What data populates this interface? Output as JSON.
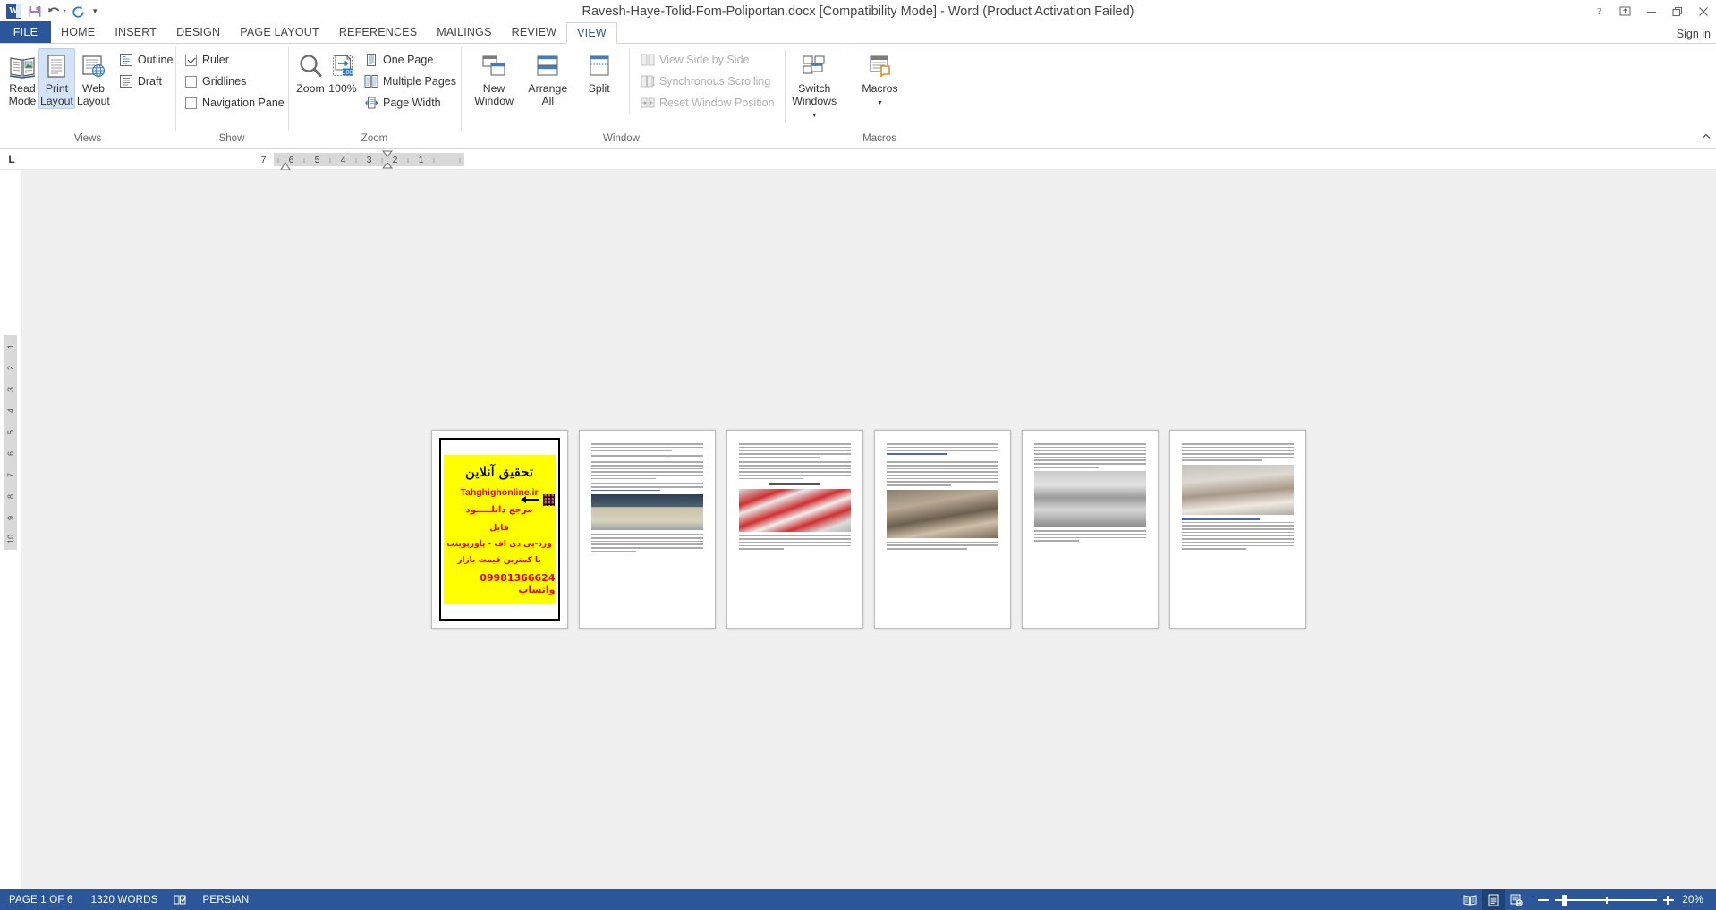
{
  "app": {
    "title": "Ravesh-Haye-Tolid-Fom-Poliportan.docx [Compatibility Mode] - Word (Product Activation Failed)",
    "sign_in": "Sign in",
    "accent": "#2b579a"
  },
  "quick_access": {
    "word_icon": "word-logo-icon",
    "save": "save-icon",
    "undo": "undo-icon",
    "redo": "redo-icon",
    "customize": "customize-qat-icon"
  },
  "window_controls": {
    "help": "help-icon",
    "ribbon_display": "ribbon-display-options-icon",
    "minimize": "minimize-icon",
    "restore": "restore-icon",
    "close": "close-icon"
  },
  "tabs": [
    {
      "label": "FILE",
      "active": false,
      "file": true
    },
    {
      "label": "HOME",
      "active": false
    },
    {
      "label": "INSERT",
      "active": false
    },
    {
      "label": "DESIGN",
      "active": false
    },
    {
      "label": "PAGE LAYOUT",
      "active": false
    },
    {
      "label": "REFERENCES",
      "active": false
    },
    {
      "label": "MAILINGS",
      "active": false
    },
    {
      "label": "REVIEW",
      "active": false
    },
    {
      "label": "VIEW",
      "active": true
    }
  ],
  "ribbon": {
    "collapse_label": "collapse-ribbon-icon",
    "groups": [
      {
        "name": "Views",
        "label": "Views",
        "buttons": [
          {
            "label_line1": "Read",
            "label_line2": "Mode",
            "icon": "read-mode-icon",
            "selected": false
          },
          {
            "label_line1": "Print",
            "label_line2": "Layout",
            "icon": "print-layout-icon",
            "selected": true
          },
          {
            "label_line1": "Web",
            "label_line2": "Layout",
            "icon": "web-layout-icon",
            "selected": false
          }
        ],
        "checks": [
          {
            "label": "Outline",
            "icon": "outline-view-icon"
          },
          {
            "label": "Draft",
            "icon": "draft-view-icon"
          }
        ]
      },
      {
        "name": "Show",
        "label": "Show",
        "checkboxes": [
          {
            "label": "Ruler",
            "checked": true
          },
          {
            "label": "Gridlines",
            "checked": false
          },
          {
            "label": "Navigation Pane",
            "checked": false
          }
        ]
      },
      {
        "name": "Zoom",
        "label": "Zoom",
        "buttons": [
          {
            "label_line1": "Zoom",
            "label_line2": "",
            "icon": "magnifier-icon"
          },
          {
            "label_line1": "100%",
            "label_line2": "",
            "icon": "zoom-100-icon"
          }
        ],
        "items": [
          {
            "label": "One Page",
            "icon": "one-page-icon"
          },
          {
            "label": "Multiple Pages",
            "icon": "multiple-pages-icon"
          },
          {
            "label": "Page Width",
            "icon": "page-width-icon"
          }
        ]
      },
      {
        "name": "Window",
        "label": "Window",
        "buttons": [
          {
            "label_line1": "New",
            "label_line2": "Window",
            "icon": "new-window-icon"
          },
          {
            "label_line1": "Arrange",
            "label_line2": "All",
            "icon": "arrange-all-icon"
          },
          {
            "label_line1": "Split",
            "label_line2": "",
            "icon": "split-icon"
          }
        ],
        "items": [
          {
            "label": "View Side by Side",
            "icon": "view-side-by-side-icon",
            "disabled": true
          },
          {
            "label": "Synchronous Scrolling",
            "icon": "synchronous-scrolling-icon",
            "disabled": true
          },
          {
            "label": "Reset Window Position",
            "icon": "reset-window-position-icon",
            "disabled": true
          }
        ],
        "switch": {
          "label_line1": "Switch",
          "label_line2": "Windows",
          "icon": "switch-windows-icon"
        }
      },
      {
        "name": "Macros",
        "label": "Macros",
        "buttons": [
          {
            "label_line1": "Macros",
            "label_line2": "",
            "icon": "macros-icon"
          }
        ]
      }
    ]
  },
  "ruler": {
    "tab_stop_marker": "L",
    "numbers_active": [
      "7"
    ],
    "numbers": [
      "6",
      "5",
      "4",
      "3",
      "2",
      "1"
    ],
    "vertical_numbers": [
      "1",
      "2",
      "3",
      "4",
      "5",
      "6",
      "7",
      "8",
      "9",
      "10"
    ]
  },
  "document": {
    "page_count": 6,
    "pages": [
      {
        "index": 1,
        "type": "poster",
        "poster": {
          "line1": "تحقیق آنلاین",
          "line2": "Tahghighonline.ir",
          "line3": "مرجع دانلـــــود",
          "line4": "فایل",
          "line5": "ورد-پی دی اف - پاورپوینت",
          "line6": "با کمترین قیمت بازار",
          "line7": "09981366624 واتساپ",
          "bg_color": "#ffff00",
          "text_color": "#e8000d"
        }
      },
      {
        "index": 2,
        "type": "text",
        "has_image": true
      },
      {
        "index": 3,
        "type": "text",
        "has_image": true
      },
      {
        "index": 4,
        "type": "text",
        "has_image": true
      },
      {
        "index": 5,
        "type": "text",
        "has_image": true
      },
      {
        "index": 6,
        "type": "text",
        "has_image": true
      }
    ]
  },
  "status_bar": {
    "page_indicator": "PAGE 1 OF 6",
    "word_count": "1320 WORDS",
    "proofing_icon": "proofing-errors-icon",
    "language": "PERSIAN",
    "view_buttons": [
      {
        "name": "read-mode-view",
        "icon": "read-mode-view-icon",
        "active": false
      },
      {
        "name": "print-layout-view",
        "icon": "print-layout-view-icon",
        "active": true
      },
      {
        "name": "web-layout-view",
        "icon": "web-layout-view-icon",
        "active": false
      }
    ],
    "zoom_out": "zoom-out-icon",
    "zoom_in": "zoom-in-icon",
    "zoom_level": "20%"
  }
}
